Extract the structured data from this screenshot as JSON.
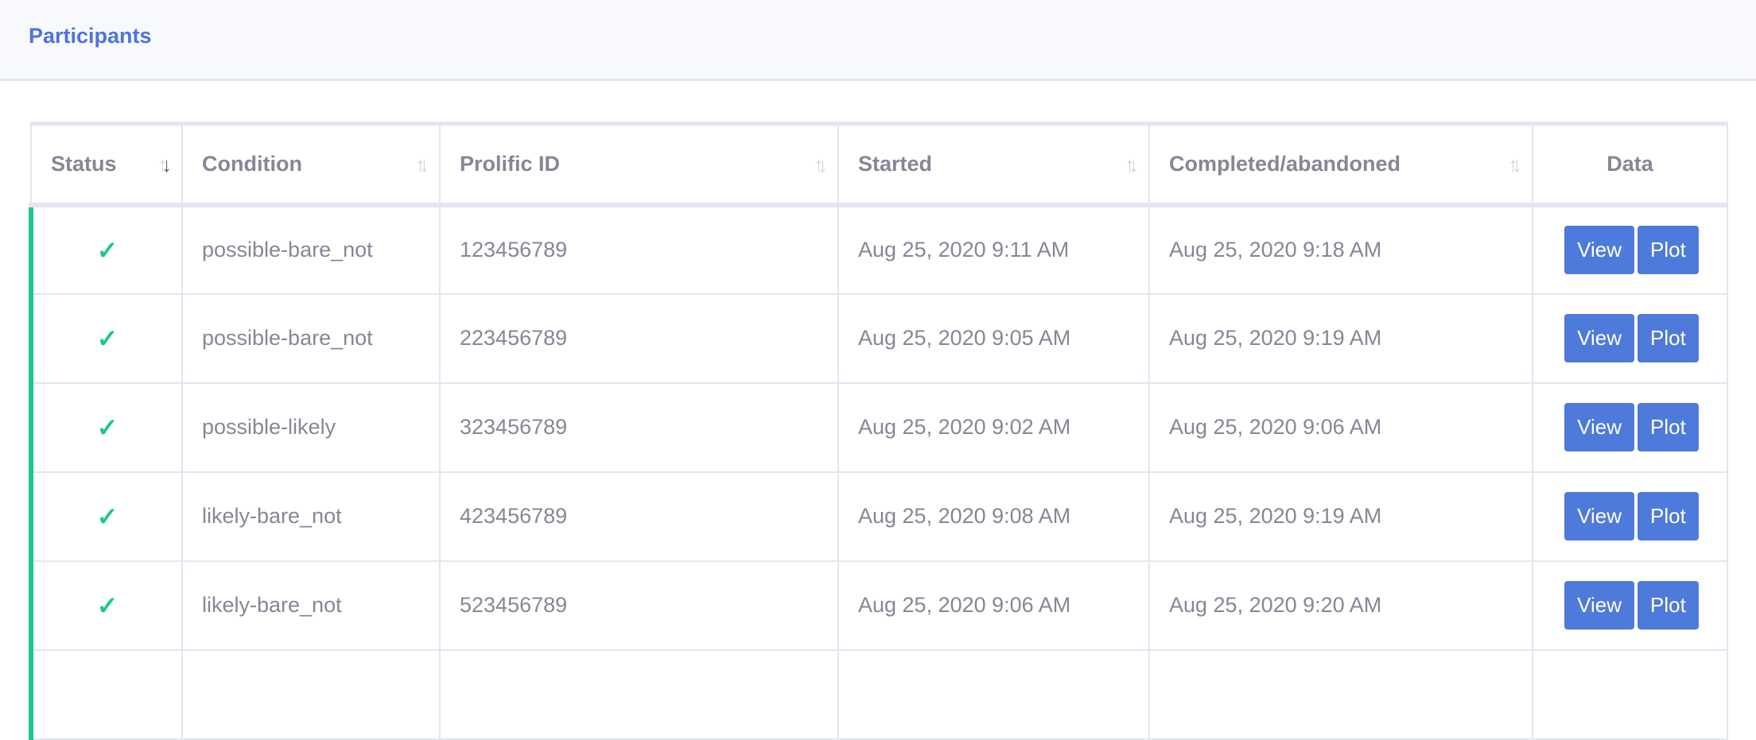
{
  "header": {
    "title": "Participants"
  },
  "table": {
    "columns": [
      {
        "label": "Status"
      },
      {
        "label": "Condition"
      },
      {
        "label": "Prolific ID"
      },
      {
        "label": "Started"
      },
      {
        "label": "Completed/abandoned"
      },
      {
        "label": "Data"
      }
    ],
    "view_label": "View",
    "plot_label": "Plot",
    "check": "✓",
    "rows": [
      {
        "condition": "possible-bare_not",
        "prolific_id": "123456789",
        "started": "Aug 25, 2020 9:11 AM",
        "completed": "Aug 25, 2020 9:18 AM"
      },
      {
        "condition": "possible-bare_not",
        "prolific_id": "223456789",
        "started": "Aug 25, 2020 9:05 AM",
        "completed": "Aug 25, 2020 9:19 AM"
      },
      {
        "condition": "possible-likely",
        "prolific_id": "323456789",
        "started": "Aug 25, 2020 9:02 AM",
        "completed": "Aug 25, 2020 9:06 AM"
      },
      {
        "condition": "likely-bare_not",
        "prolific_id": "423456789",
        "started": "Aug 25, 2020 9:08 AM",
        "completed": "Aug 25, 2020 9:19 AM"
      },
      {
        "condition": "likely-bare_not",
        "prolific_id": "523456789",
        "started": "Aug 25, 2020 9:06 AM",
        "completed": "Aug 25, 2020 9:20 AM"
      }
    ]
  }
}
